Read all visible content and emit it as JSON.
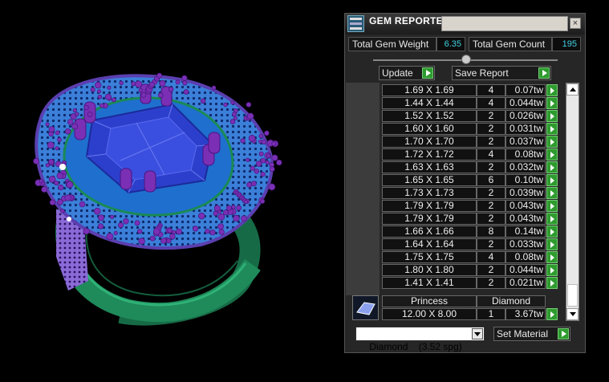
{
  "panel": {
    "title": "GEM REPORTER",
    "close_glyph": "×",
    "total_gem_weight_label": "Total Gem Weight",
    "total_gem_weight_value": "6.35",
    "total_gem_count_label": "Total Gem Count",
    "total_gem_count_value": "195",
    "update_label": "Update",
    "save_report_label": "Save Report",
    "gem_rows": [
      {
        "size": "1.69 X 1.69",
        "count": "4",
        "weight": "0.07tw"
      },
      {
        "size": "1.44 X 1.44",
        "count": "4",
        "weight": "0.044tw"
      },
      {
        "size": "1.52 X 1.52",
        "count": "2",
        "weight": "0.026tw"
      },
      {
        "size": "1.60 X 1.60",
        "count": "2",
        "weight": "0.031tw"
      },
      {
        "size": "1.70 X 1.70",
        "count": "2",
        "weight": "0.037tw"
      },
      {
        "size": "1.72 X 1.72",
        "count": "4",
        "weight": "0.08tw"
      },
      {
        "size": "1.63 X 1.63",
        "count": "2",
        "weight": "0.032tw"
      },
      {
        "size": "1.65 X 1.65",
        "count": "6",
        "weight": "0.10tw"
      },
      {
        "size": "1.73 X 1.73",
        "count": "2",
        "weight": "0.039tw"
      },
      {
        "size": "1.79 X 1.79",
        "count": "2",
        "weight": "0.043tw"
      },
      {
        "size": "1.79 X 1.79",
        "count": "2",
        "weight": "0.043tw"
      },
      {
        "size": "1.66 X 1.66",
        "count": "8",
        "weight": "0.14tw"
      },
      {
        "size": "1.64 X 1.64",
        "count": "2",
        "weight": "0.033tw"
      },
      {
        "size": "1.75 X 1.75",
        "count": "4",
        "weight": "0.08tw"
      },
      {
        "size": "1.80 X 1.80",
        "count": "2",
        "weight": "0.044tw"
      },
      {
        "size": "1.41 X 1.41",
        "count": "2",
        "weight": "0.021tw"
      }
    ],
    "selected_gem": {
      "cut": "Princess",
      "material": "Diamond",
      "size": "12.00 X 8.00",
      "count": "1",
      "weight": "3.67tw"
    },
    "material_dropdown_value": "Diamond    (3.52 spg)",
    "set_material_label": "Set Material"
  },
  "colors": {
    "accent_value": "#40d0e0",
    "go_button": "#2e9b2e",
    "ring_metal": "#1f8a5a",
    "gem_face": "#2c3fcc",
    "small_stones": "#7a2fb5",
    "halo_metal": "#3a7fd8"
  },
  "icons": {
    "app": "gem-reporter-icon",
    "close": "close-icon",
    "go": "play-arrow-icon"
  }
}
